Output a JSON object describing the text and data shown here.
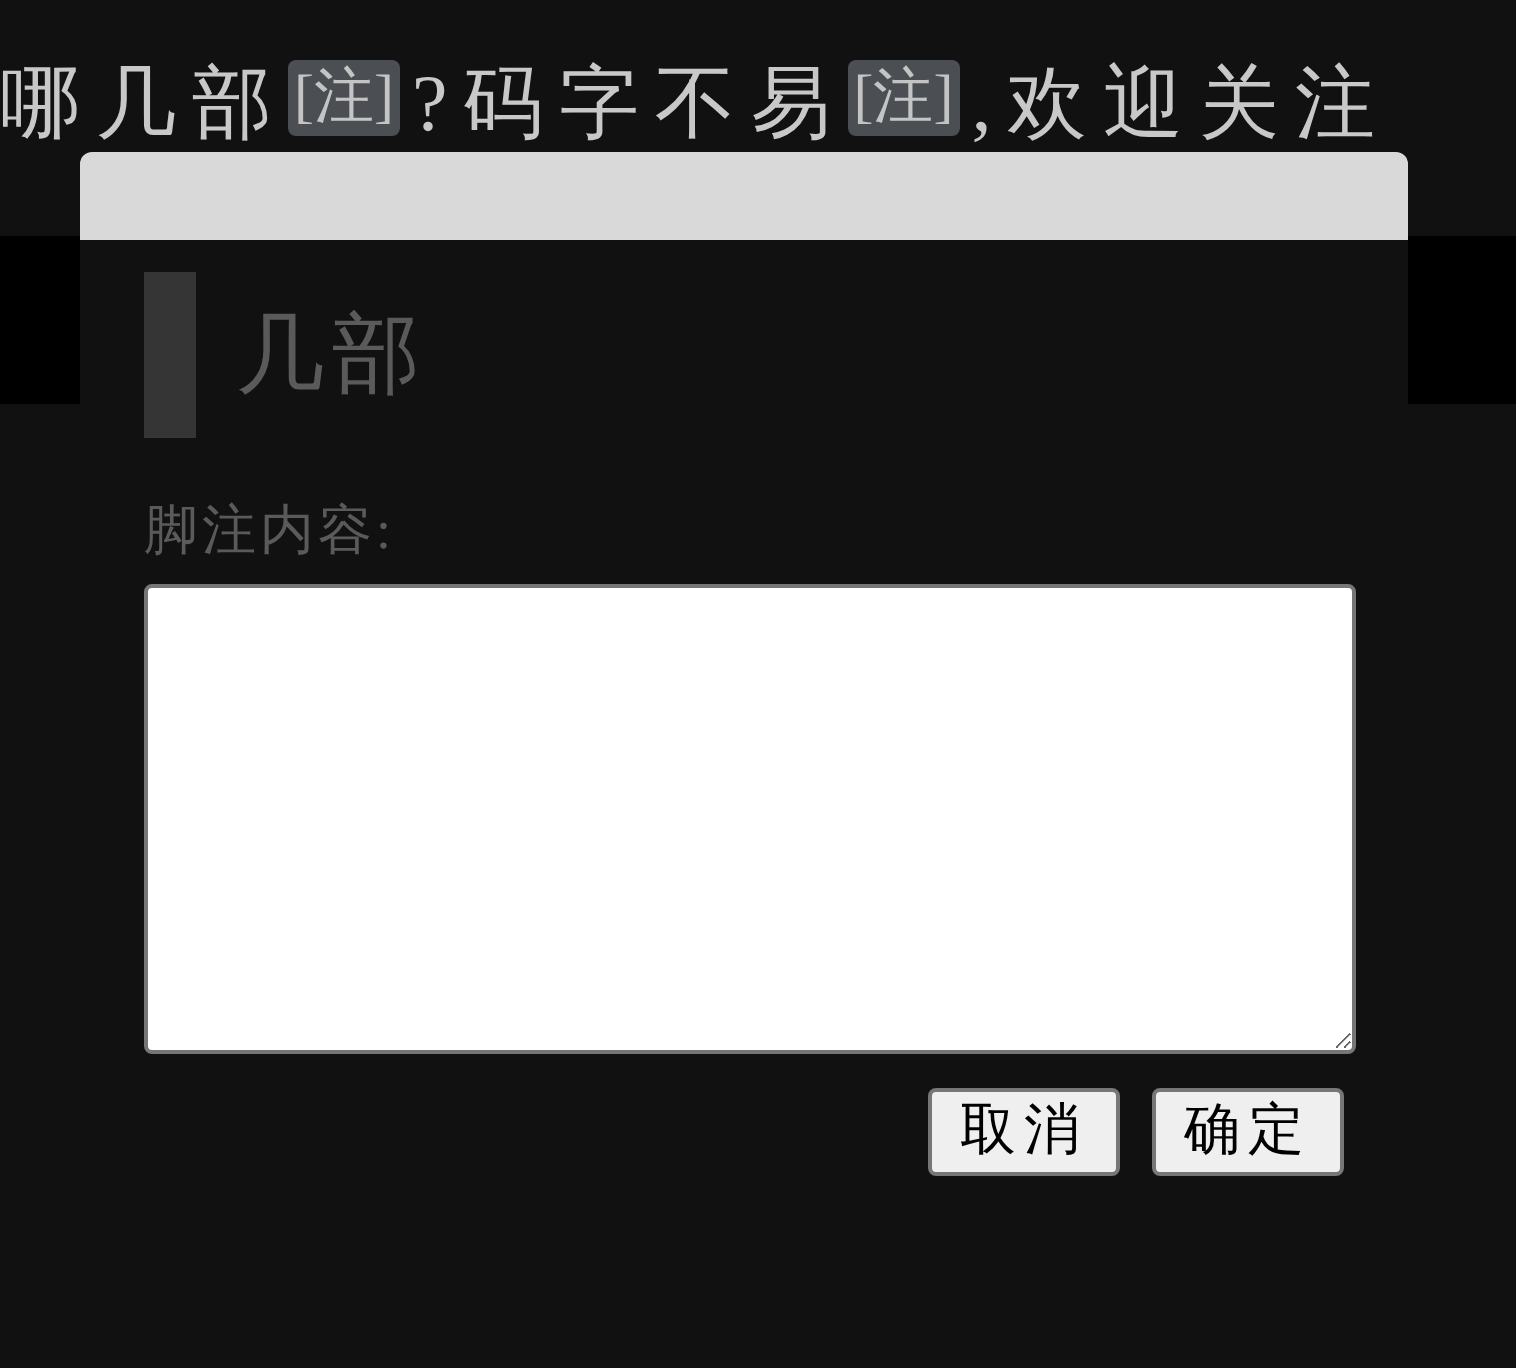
{
  "article_line": {
    "segments": [
      {
        "kind": "text",
        "text": "哪几部"
      },
      {
        "kind": "note",
        "text": "[注]"
      },
      {
        "kind": "text",
        "text": "?码字不易"
      },
      {
        "kind": "note",
        "text": "[注]"
      },
      {
        "kind": "text",
        "text": ",欢迎关注"
      }
    ]
  },
  "dialog": {
    "title": "几部",
    "field_label": "脚注内容:",
    "buttons": [
      {
        "label": "取消"
      },
      {
        "label": "确定"
      }
    ]
  }
}
